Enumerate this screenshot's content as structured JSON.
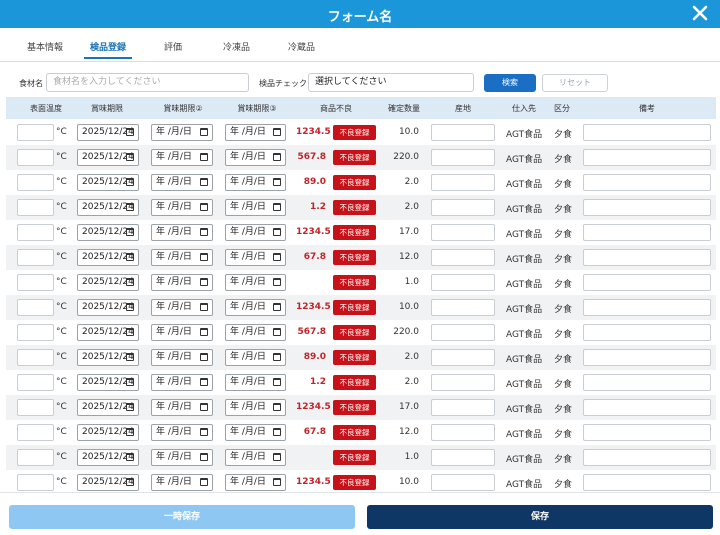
{
  "window": {
    "title": "フォーム名"
  },
  "tabs": [
    {
      "label": "基本情報",
      "active": false
    },
    {
      "label": "検品登録",
      "active": true
    },
    {
      "label": "評価",
      "active": false
    },
    {
      "label": "冷凍品",
      "active": false
    },
    {
      "label": "冷蔵品",
      "active": false
    }
  ],
  "filters": {
    "ingredient_label": "食材名",
    "ingredient_placeholder": "食材名を入力してください",
    "inspection_label": "検品チェック",
    "inspection_value": "選択してください",
    "search_label": "検索",
    "reset_label": "リセット"
  },
  "table": {
    "headers": [
      "表面温度",
      "賞味期限",
      "賞味期限②",
      "賞味期限③",
      "商品不良",
      "確定数量",
      "産地",
      "仕入先",
      "区分",
      "備考"
    ],
    "temp_unit": "°C",
    "bad_button_label": "不良登録",
    "date_placeholder": "年 /月/日",
    "rows": [
      {
        "expiry": "2025/12/24",
        "bad_value": "1234.5",
        "qty": "10.0",
        "supplier": "AGT食品",
        "category": "夕食"
      },
      {
        "expiry": "2025/12/24",
        "bad_value": "567.8",
        "qty": "220.0",
        "supplier": "AGT食品",
        "category": "夕食"
      },
      {
        "expiry": "2025/12/24",
        "bad_value": "89.0",
        "qty": "2.0",
        "supplier": "AGT食品",
        "category": "夕食"
      },
      {
        "expiry": "2025/12/24",
        "bad_value": "1.2",
        "qty": "2.0",
        "supplier": "AGT食品",
        "category": "夕食"
      },
      {
        "expiry": "2025/12/24",
        "bad_value": "1234.5",
        "qty": "17.0",
        "supplier": "AGT食品",
        "category": "夕食"
      },
      {
        "expiry": "2025/12/24",
        "bad_value": "67.8",
        "qty": "12.0",
        "supplier": "AGT食品",
        "category": "夕食"
      },
      {
        "expiry": "2025/12/24",
        "bad_value": "",
        "qty": "1.0",
        "supplier": "AGT食品",
        "category": "夕食"
      },
      {
        "expiry": "2025/12/24",
        "bad_value": "1234.5",
        "qty": "10.0",
        "supplier": "AGT食品",
        "category": "夕食"
      },
      {
        "expiry": "2025/12/24",
        "bad_value": "567.8",
        "qty": "220.0",
        "supplier": "AGT食品",
        "category": "夕食"
      },
      {
        "expiry": "2025/12/24",
        "bad_value": "89.0",
        "qty": "2.0",
        "supplier": "AGT食品",
        "category": "夕食"
      },
      {
        "expiry": "2025/12/24",
        "bad_value": "1.2",
        "qty": "2.0",
        "supplier": "AGT食品",
        "category": "夕食"
      },
      {
        "expiry": "2025/12/24",
        "bad_value": "1234.5",
        "qty": "17.0",
        "supplier": "AGT食品",
        "category": "夕食"
      },
      {
        "expiry": "2025/12/24",
        "bad_value": "67.8",
        "qty": "12.0",
        "supplier": "AGT食品",
        "category": "夕食"
      },
      {
        "expiry": "2025/12/24",
        "bad_value": "",
        "qty": "1.0",
        "supplier": "AGT食品",
        "category": "夕食"
      },
      {
        "expiry": "2025/12/24",
        "bad_value": "1234.5",
        "qty": "10.0",
        "supplier": "AGT食品",
        "category": "夕食"
      }
    ]
  },
  "footer": {
    "temp_save_label": "一時保存",
    "save_label": "保存"
  },
  "colors": {
    "header_blue": "#1b97d9",
    "tab_active": "#1a74b8",
    "bad_red": "#c8121a",
    "save_navy": "#0e3765",
    "temp_save": "#8ec8f2"
  }
}
